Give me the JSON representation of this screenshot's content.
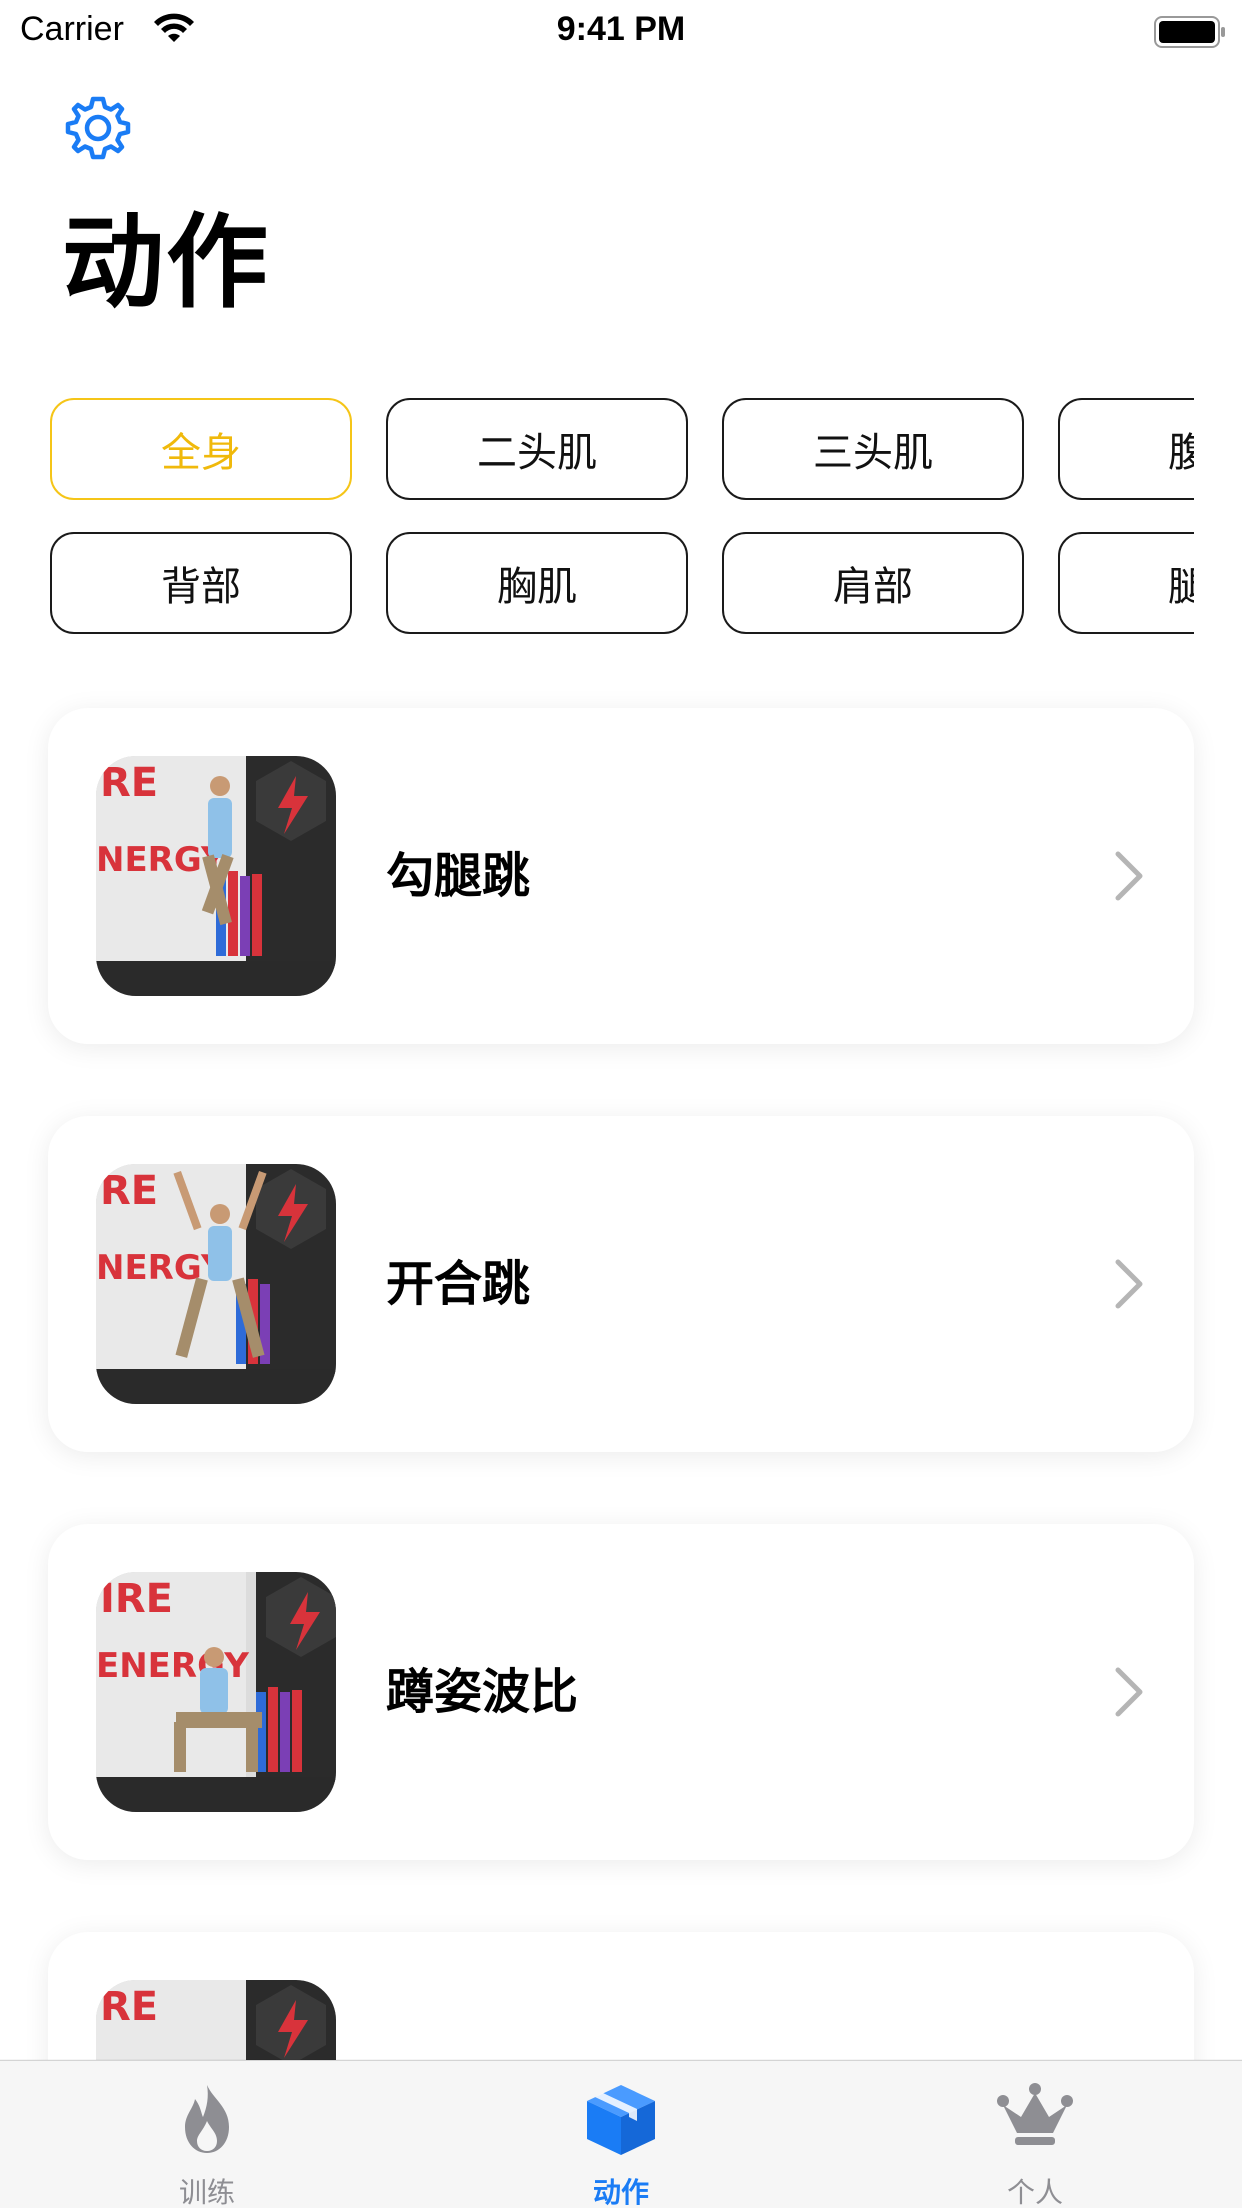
{
  "status_bar": {
    "carrier": "Carrier",
    "time": "9:41 PM"
  },
  "header": {
    "title": "动作",
    "settings_icon": "gear-icon"
  },
  "filters": {
    "row1": [
      "全身",
      "二头肌",
      "三头肌",
      "腹"
    ],
    "row2": [
      "背部",
      "胸肌",
      "肩部",
      "腿"
    ],
    "selected": "全身"
  },
  "exercises": [
    {
      "name": "勾腿跳",
      "thumbnail": "exercise-photo"
    },
    {
      "name": "开合跳",
      "thumbnail": "exercise-photo"
    },
    {
      "name": "蹲姿波比",
      "thumbnail": "exercise-photo"
    },
    {
      "name": "",
      "thumbnail": "exercise-photo"
    }
  ],
  "tab_bar": {
    "tabs": [
      {
        "label": "训练",
        "icon": "flame-icon"
      },
      {
        "label": "动作",
        "icon": "cube-icon"
      },
      {
        "label": "个人",
        "icon": "crown-icon"
      }
    ],
    "active": "动作"
  },
  "colors": {
    "accent": "#1a7cf5",
    "selected_chip": "#f5c518",
    "tab_inactive": "#8e8e93",
    "background": "#ffffff"
  }
}
